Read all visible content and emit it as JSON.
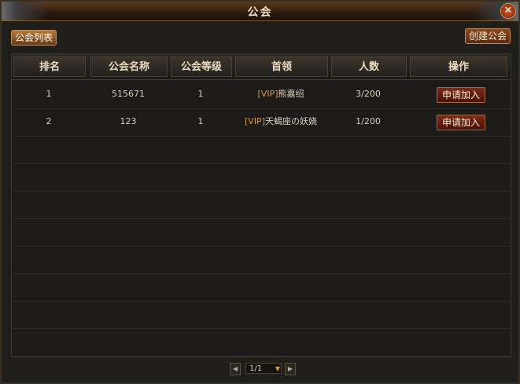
{
  "window": {
    "title": "公会",
    "close_glyph": "✕"
  },
  "tabs": [
    {
      "label": "公会列表"
    }
  ],
  "create_button": "创建公会",
  "table": {
    "headers": [
      "排名",
      "公会名称",
      "公会等级",
      "首领",
      "人数",
      "操作"
    ],
    "rows": [
      {
        "rank": "1",
        "name": "515671",
        "level": "1",
        "leader_prefix": "[VIP]",
        "leader": "熊嘉绍",
        "members": "3/200",
        "action": "申请加入"
      },
      {
        "rank": "2",
        "name": "123",
        "level": "1",
        "leader_prefix": "[VIP]",
        "leader": "天蝎座の妖娆",
        "members": "1/200",
        "action": "申请加入"
      }
    ],
    "empty_rows": 8
  },
  "pager": {
    "text": "1/1",
    "prev": "◀",
    "next": "▶",
    "drop": "▼"
  }
}
